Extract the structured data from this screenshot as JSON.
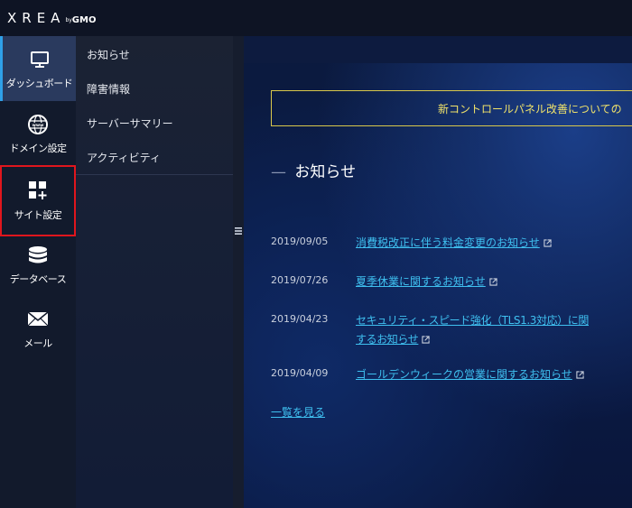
{
  "header": {
    "logo_main": "XREA",
    "logo_by": "by",
    "logo_gmo": "GMO"
  },
  "rail": {
    "items": [
      {
        "label": "ダッシュボード",
        "icon": "monitor-icon",
        "active": true
      },
      {
        "label": "ドメイン設定",
        "icon": "globe-www-icon"
      },
      {
        "label": "サイト設定",
        "icon": "site-grid-icon",
        "highlighted": true
      },
      {
        "label": "データベース",
        "icon": "database-icon"
      },
      {
        "label": "メール",
        "icon": "envelope-icon"
      }
    ]
  },
  "submenu": {
    "items": [
      {
        "label": "お知らせ"
      },
      {
        "label": "障害情報"
      },
      {
        "label": "サーバーサマリー"
      },
      {
        "label": "アクティビティ"
      }
    ]
  },
  "main": {
    "notice_text": "新コントロールパネル改善についての",
    "section_dash": "—",
    "section_title": "お知らせ",
    "news": [
      {
        "date": "2019/09/05",
        "title": "消費税改正に伴う料金変更のお知らせ"
      },
      {
        "date": "2019/07/26",
        "title": "夏季休業に関するお知らせ"
      },
      {
        "date": "2019/04/23",
        "title_line1": "セキュリティ・スピード強化（TLS1.3対応）に関",
        "title_line2": "するお知らせ"
      },
      {
        "date": "2019/04/09",
        "title": "ゴールデンウィークの営業に関するお知らせ"
      }
    ],
    "all_link": "一覧を見る"
  },
  "colors": {
    "accent": "#2fa0e8",
    "link": "#3fc0f0",
    "notice_border": "#d9c84b",
    "highlight": "#e0161d"
  }
}
